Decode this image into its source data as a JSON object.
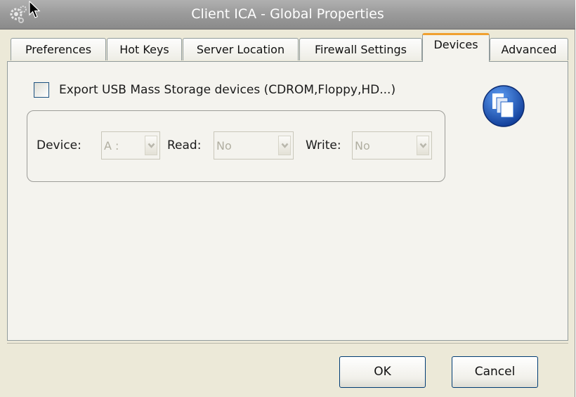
{
  "window": {
    "title": "Client ICA - Global Properties",
    "icon": "gears-icon"
  },
  "tabs": [
    {
      "label": "Preferences",
      "active": false
    },
    {
      "label": "Hot Keys",
      "active": false
    },
    {
      "label": "Server Location",
      "active": false
    },
    {
      "label": "Firewall Settings",
      "active": false
    },
    {
      "label": "Devices",
      "active": true
    },
    {
      "label": "Advanced",
      "active": false
    }
  ],
  "devices": {
    "export_checkbox": {
      "label": "Export USB Mass Storage devices (CDROM,Floppy,HD...)",
      "checked": false
    },
    "device": {
      "label": "Device:",
      "value": "A :",
      "enabled": false
    },
    "read": {
      "label": "Read:",
      "value": "No",
      "enabled": false
    },
    "write": {
      "label": "Write:",
      "value": "No",
      "enabled": false
    },
    "badge_icon": "usb-windows-icon"
  },
  "footer": {
    "ok_label": "OK",
    "cancel_label": "Cancel"
  },
  "colors": {
    "titlebar": "#9c9c9c",
    "window_bg": "#ece9d8",
    "panel_bg": "#f4f3ee",
    "active_tab_accent": "#f0a030",
    "badge_blue": "#1f5fc6"
  }
}
